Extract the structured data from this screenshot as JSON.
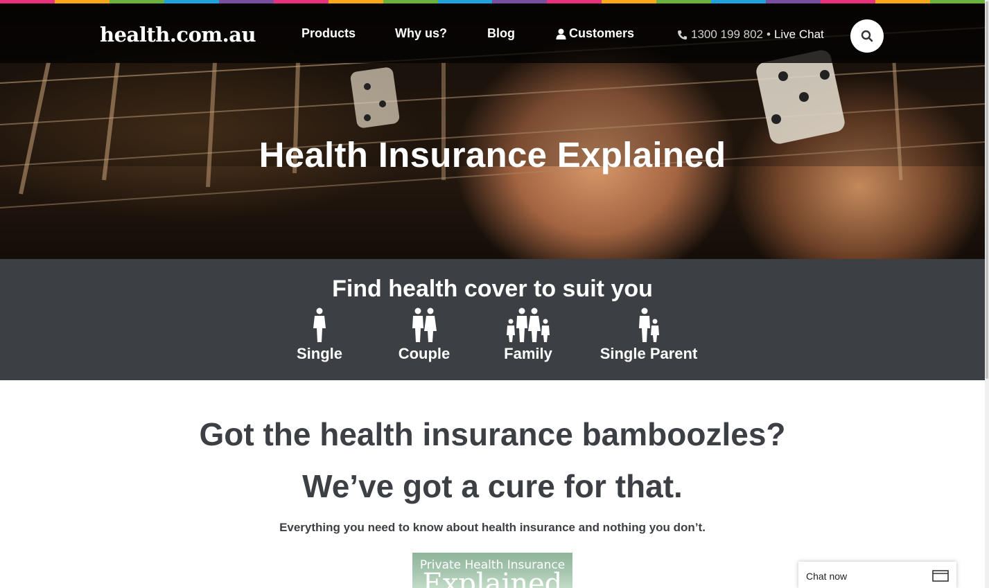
{
  "brand": {
    "logo": "health.com.au",
    "stripe_colors": [
      "#e8327c",
      "#f7a81b",
      "#6ab43e",
      "#1fa3dc",
      "#7b4fa0",
      "#e8327c",
      "#f7a81b",
      "#6ab43e",
      "#1fa3dc",
      "#7b4fa0",
      "#e8327c",
      "#f7a81b",
      "#6ab43e",
      "#1fa3dc",
      "#7b4fa0",
      "#e8327c",
      "#f7a81b",
      "#6ab43e"
    ]
  },
  "nav": {
    "items": [
      {
        "label": "Products"
      },
      {
        "label": "Why us?"
      },
      {
        "label": "Blog"
      },
      {
        "label": "Customers",
        "icon": "user-icon"
      }
    ],
    "phone": "1300 199 802",
    "separator": "•",
    "live_chat": "Live Chat",
    "search_icon": "search-icon"
  },
  "hero": {
    "title": "Health Insurance Explained"
  },
  "finder": {
    "title": "Find health cover to suit you",
    "options": [
      {
        "label": "Single",
        "icon": "single-person-icon"
      },
      {
        "label": "Couple",
        "icon": "couple-icon"
      },
      {
        "label": "Family",
        "icon": "family-icon"
      },
      {
        "label": "Single Parent",
        "icon": "single-parent-icon"
      }
    ]
  },
  "main": {
    "headline1": "Got the health insurance bamboozles?",
    "headline2": "We’ve got a cure for that.",
    "tagline": "Everything you need to know about health insurance and nothing you don’t.",
    "thumbnail": {
      "line1": "Private Health Insurance",
      "line2": "Explained"
    }
  },
  "chat_widget": {
    "label": "Chat now",
    "icon": "expand-window-icon"
  }
}
